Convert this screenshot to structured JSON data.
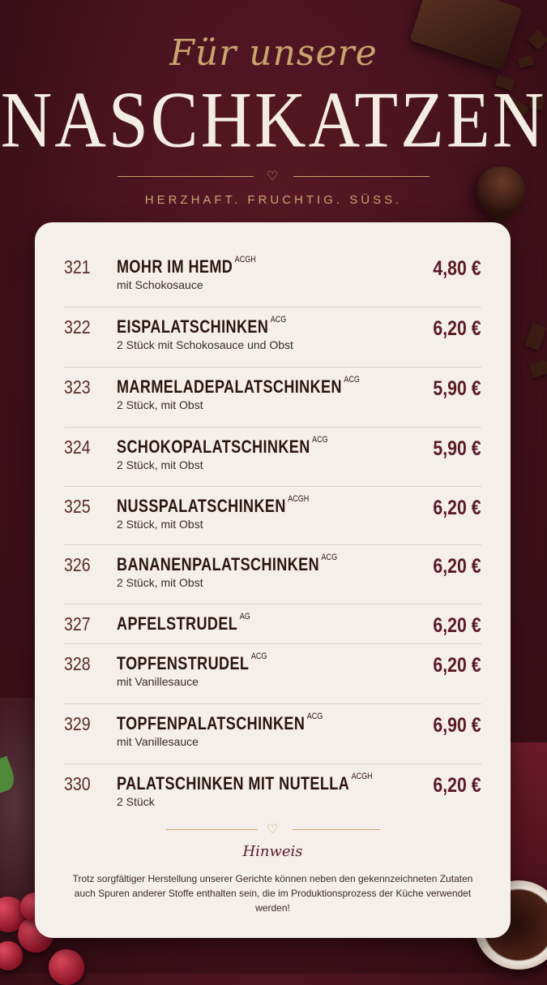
{
  "header": {
    "script_title": "Für unsere",
    "main_title": "NASCHKATZEN",
    "tagline": "HERZHAFT. FRUCHTIG. SÜSS.",
    "divider_icon": "heart-icon"
  },
  "colors": {
    "background": "#4a1320",
    "accent_gold": "#c9a46e",
    "card": "#f4efea",
    "price": "#5a1a26"
  },
  "menu": {
    "items": [
      {
        "number": "321",
        "name": "MOHR IM HEMD",
        "allergens": "ACGH",
        "description": "mit Schokosauce",
        "price": "4,80 €"
      },
      {
        "number": "322",
        "name": "EISPALATSCHINKEN",
        "allergens": "ACG",
        "description": "2 Stück mit Schokosauce und Obst",
        "price": "6,20 €"
      },
      {
        "number": "323",
        "name": "MARMELADEPALATSCHINKEN",
        "allergens": "ACG",
        "description": "2 Stück, mit Obst",
        "price": "5,90 €"
      },
      {
        "number": "324",
        "name": "SCHOKOPALATSCHINKEN",
        "allergens": "ACG",
        "description": "2 Stück, mit Obst",
        "price": "5,90 €"
      },
      {
        "number": "325",
        "name": "NUSSPALATSCHINKEN",
        "allergens": "ACGH",
        "description": "2 Stück, mit Obst",
        "price": "6,20 €"
      },
      {
        "number": "326",
        "name": "BANANENPALATSCHINKEN",
        "allergens": "ACG",
        "description": "2 Stück, mit Obst",
        "price": "6,20 €"
      },
      {
        "number": "327",
        "name": "APFELSTRUDEL",
        "allergens": "AG",
        "description": "",
        "price": "6,20 €"
      },
      {
        "number": "328",
        "name": "TOPFENSTRUDEL",
        "allergens": "ACG",
        "description": "mit Vanillesauce",
        "price": "6,20 €"
      },
      {
        "number": "329",
        "name": "TOPFENPALATSCHINKEN",
        "allergens": "ACG",
        "description": "mit Vanillesauce",
        "price": "6,90 €"
      },
      {
        "number": "330",
        "name": "PALATSCHINKEN MIT NUTELLA",
        "allergens": "ACGH",
        "description": "2 Stück",
        "price": "6,20 €"
      }
    ]
  },
  "note": {
    "title": "Hinweis",
    "text": "Trotz sorgfältiger Herstellung unserer Gerichte können neben den gekennzeichneten Zutaten auch Spuren anderer Stoffe enthalten sein, die im Produktionsprozess der Küche verwendet werden!"
  }
}
